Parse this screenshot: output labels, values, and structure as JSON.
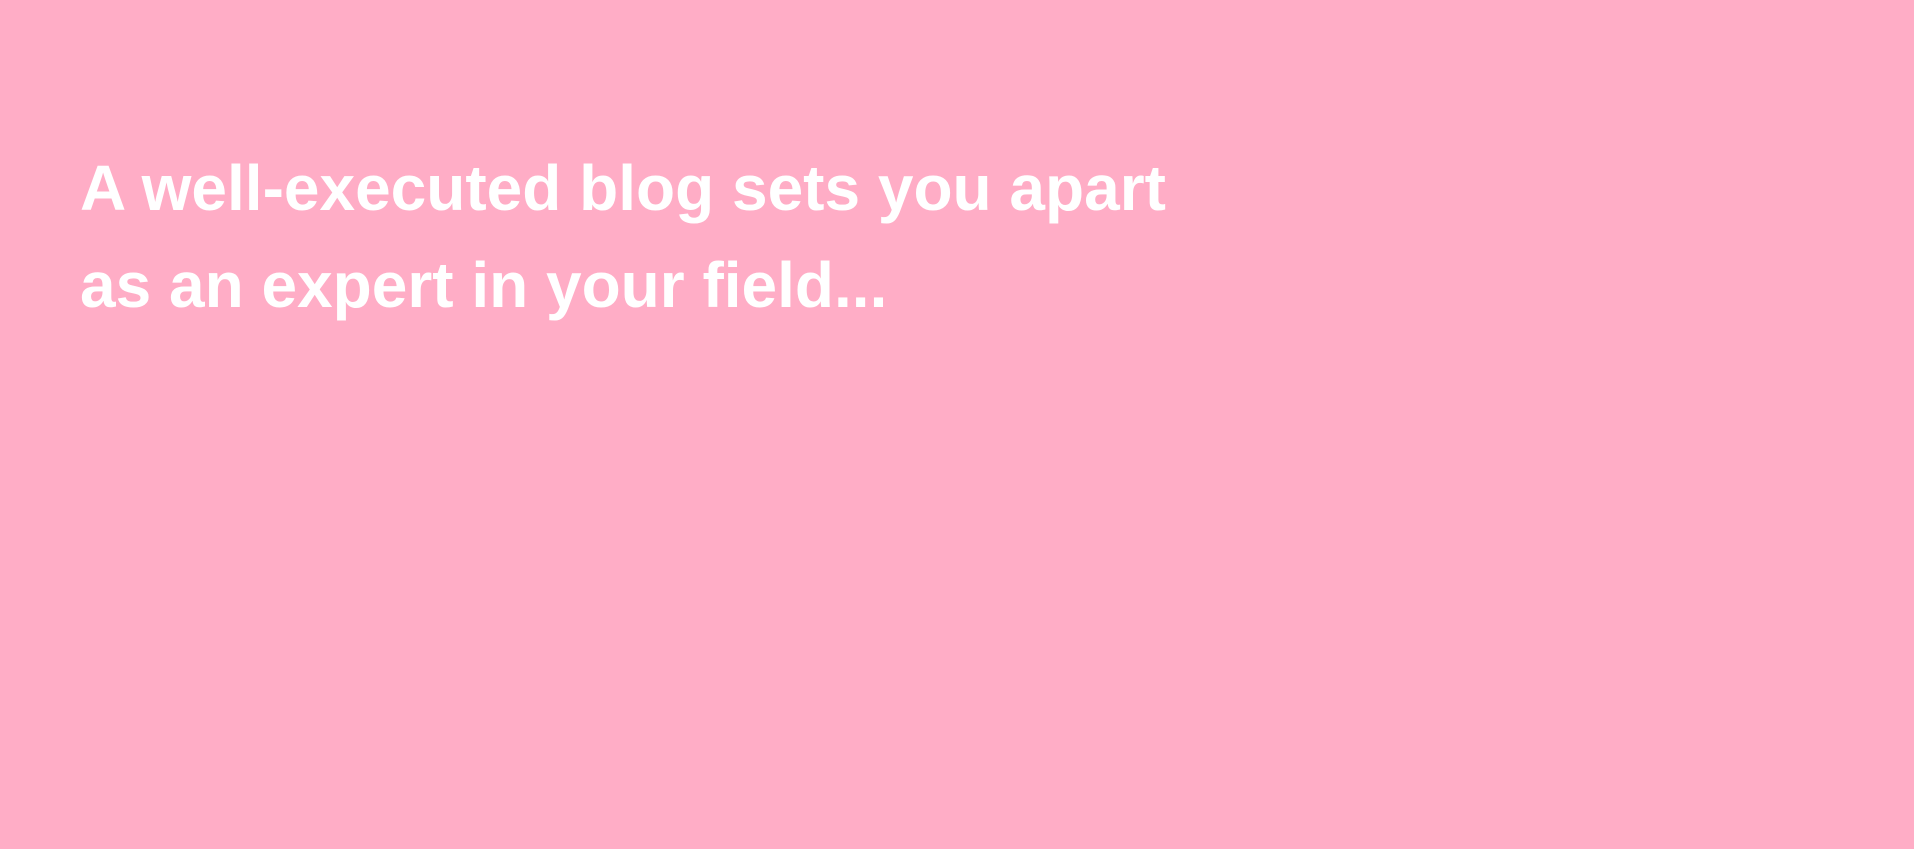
{
  "slide": {
    "background_color": "#ffadc6",
    "text_color": "#ffffff",
    "headline": {
      "line1": "A well-executed blog sets you apart",
      "line2": "as an expert in your field..."
    }
  }
}
